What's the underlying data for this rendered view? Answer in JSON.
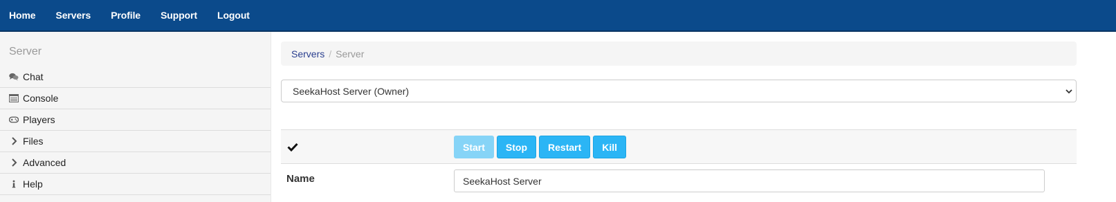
{
  "nav": {
    "items": [
      {
        "label": "Home"
      },
      {
        "label": "Servers"
      },
      {
        "label": "Profile"
      },
      {
        "label": "Support"
      },
      {
        "label": "Logout"
      }
    ]
  },
  "sidebar": {
    "heading": "Server",
    "items": [
      {
        "label": "Chat",
        "icon": "chat-bubbles-icon"
      },
      {
        "label": "Console",
        "icon": "console-window-icon"
      },
      {
        "label": "Players",
        "icon": "gamepad-icon"
      },
      {
        "label": "Files",
        "icon": "chevron-right-icon"
      },
      {
        "label": "Advanced",
        "icon": "chevron-right-icon"
      },
      {
        "label": "Help",
        "icon": "info-icon"
      }
    ]
  },
  "breadcrumb": {
    "link": "Servers",
    "separator": "/",
    "current": "Server"
  },
  "server_select": {
    "selected": "SeekaHost Server (Owner)"
  },
  "controls": {
    "status_icon": "checkmark-icon",
    "start": "Start",
    "stop": "Stop",
    "restart": "Restart",
    "kill": "Kill"
  },
  "name_field": {
    "label": "Name",
    "value": "SeekaHost Server"
  },
  "colors": {
    "navbar": "#0b4a8b",
    "button": "#2bb5f5",
    "button_disabled": "#86d4f7",
    "link": "#2a3f8f"
  }
}
